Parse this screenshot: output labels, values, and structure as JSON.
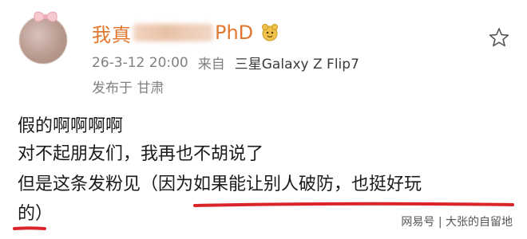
{
  "post": {
    "username_start": "我真",
    "username_end": "PhD",
    "timestamp": "26-3-12 20:00",
    "source_label": "来自",
    "device": "三星Galaxy Z Flip7",
    "location": "发布于 甘肃",
    "lines": [
      "假的啊啊啊啊",
      "对不起朋友们，我再也不胡说了",
      "但是这条发粉见（因为如果能让别人破防，也挺好玩",
      "的）"
    ]
  },
  "watermark": "网易号 | 大张的自留地",
  "icons": {
    "star": "favorite-star-icon",
    "badge": "user-badge-icon",
    "bow": "bow-decoration-icon"
  },
  "colors": {
    "username": "#e2772f",
    "annotation_underline": "#d9252a"
  }
}
